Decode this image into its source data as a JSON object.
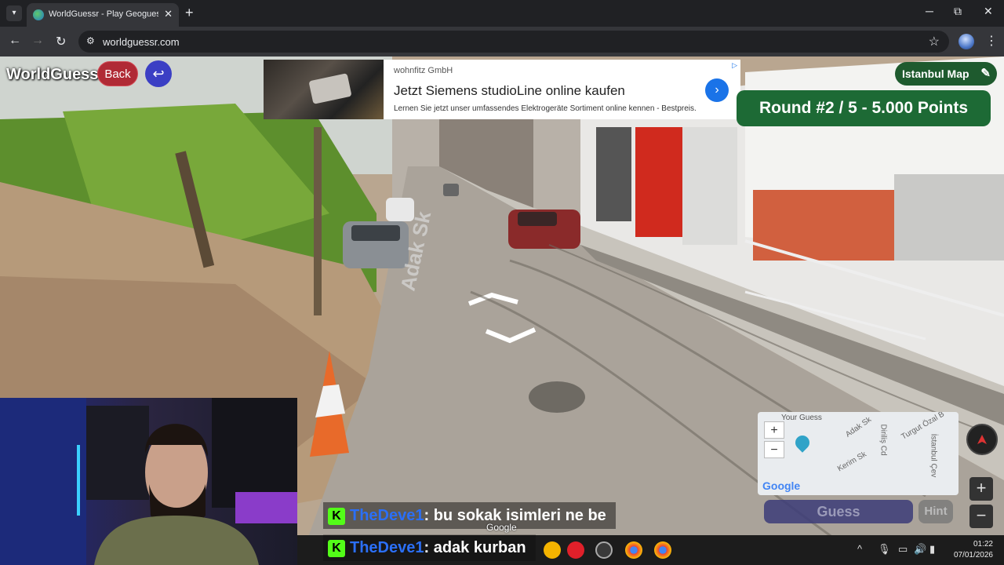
{
  "browser": {
    "tab_title": "WorldGuessr - Play Geoguessr F",
    "url": "worldguessr.com",
    "window_controls": [
      "─",
      "⧉",
      "✕"
    ]
  },
  "game": {
    "logo": "WorldGuessr",
    "back_label": "Back",
    "map_name": "Istanbul Map",
    "round_text": "Round #2 / 5 - 5.000 Points",
    "guess_label": "Guess",
    "hint_label": "Hint",
    "street_sign": "Adak Sk",
    "google_watermark": "Google"
  },
  "ad": {
    "advertiser": "wohnfitz GmbH",
    "headline": "Jetzt Siemens studioLine online kaufen",
    "description": "Lernen Sie jetzt unser umfassendes Elektrogeräte Sortiment online kennen - Bestpreis."
  },
  "minimap": {
    "label": "Your Guess",
    "zoom_in": "+",
    "zoom_out": "−",
    "streets": [
      "Adak Sk",
      "Diriliş Cd",
      "Turgut Özal B",
      "Kerim Sk",
      "İstanbul Çev"
    ],
    "google": "Google"
  },
  "chat": [
    {
      "user": "TheDeve1",
      "message": ": bu sokak isimleri ne be"
    },
    {
      "user": "TheDeve1",
      "message": ": adak kurban"
    }
  ],
  "taskbar": {
    "time": "01:22",
    "date": "07/01/2026"
  },
  "icons": {
    "accent_green": "#1d6a35",
    "back_red": "#b02a35",
    "kick_green": "#53fc18"
  }
}
